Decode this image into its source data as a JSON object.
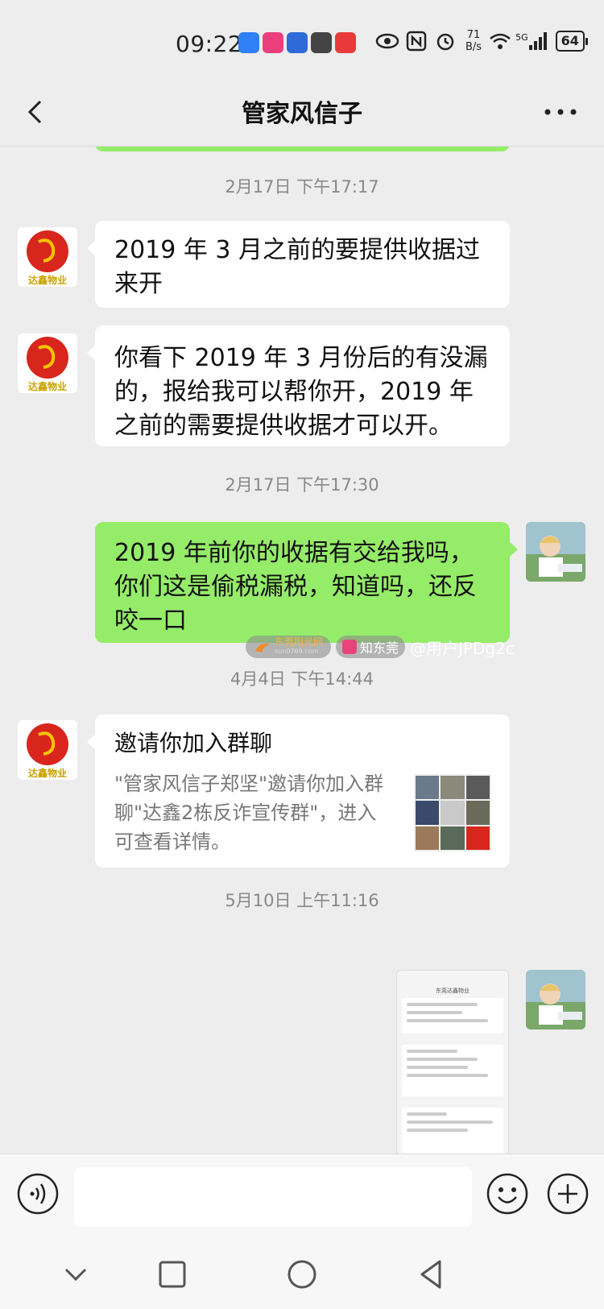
{
  "status_bar": {
    "time": "09:22",
    "net_speed": "71",
    "net_unit": "B/s",
    "signal_label": "5G",
    "battery": "64"
  },
  "header": {
    "title": "管家风信子"
  },
  "avatars": {
    "contact_logo_text": "达鑫物业"
  },
  "messages": [
    {
      "type": "timestamp",
      "text": "2月17日 下午17:17"
    },
    {
      "type": "in",
      "text": "2019 年 3 月之前的要提供收据过来开"
    },
    {
      "type": "in",
      "text": "你看下 2019 年 3 月份后的有没漏的，报给我可以帮你开，2019 年之前的需要提供收据才可以开。"
    },
    {
      "type": "timestamp",
      "text": "2月17日 下午17:30"
    },
    {
      "type": "out",
      "text": "2019 年前你的收据有交给我吗，你们这是偷税漏税，知道吗，还反咬一口"
    },
    {
      "type": "timestamp",
      "text": "4月4日 下午14:44"
    },
    {
      "type": "invite",
      "title": "邀请你加入群聊",
      "desc": "\"管家风信子郑坚\"邀请你加入群聊\"达鑫2栋反诈宣传群\"，进入可查看详情。"
    },
    {
      "type": "timestamp",
      "text": "5月10日 上午11:16"
    },
    {
      "type": "out-image",
      "text": "东莞达鑫物业"
    }
  ],
  "watermark": {
    "site": "东莞阳光网",
    "site_sub": "sun0769.com",
    "brand": "知东莞",
    "user": "@用户JPDg2c"
  },
  "input": {
    "placeholder": ""
  },
  "colors": {
    "background": "#ededed",
    "bubble_out": "#95ec69",
    "bubble_in": "#ffffff",
    "timestamp": "#888888"
  }
}
